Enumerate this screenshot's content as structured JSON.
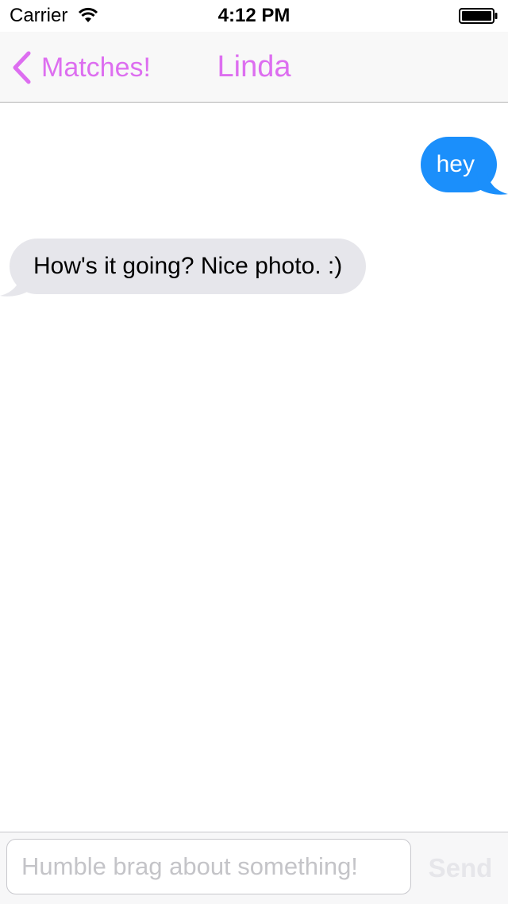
{
  "status_bar": {
    "carrier": "Carrier",
    "time": "4:12 PM",
    "icons": [
      "wifi-icon",
      "battery-icon"
    ]
  },
  "nav": {
    "back_label": "Matches!",
    "title": "Linda",
    "back_icon": "chevron-left-icon",
    "accent_color": "#dd6ef0"
  },
  "messages": [
    {
      "direction": "outgoing",
      "text": "hey",
      "bubble_color": "#1b8ffb"
    },
    {
      "direction": "incoming",
      "text": "How's it going? Nice photo. :)",
      "bubble_color": "#e6e6eb"
    }
  ],
  "composer": {
    "placeholder": "Humble brag about something!",
    "value": "",
    "send_label": "Send"
  }
}
